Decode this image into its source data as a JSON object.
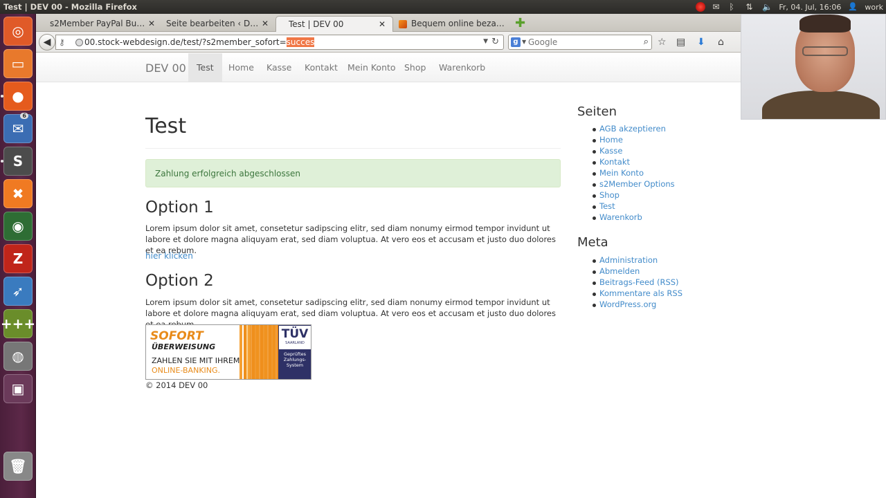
{
  "os": {
    "window_title": "Test | DEV 00 - Mozilla Firefox",
    "clock": "Fr, 04. Jul, 16:06",
    "user": "work",
    "launcher": [
      {
        "name": "ubuntu-dash-icon",
        "color": "#e05a28"
      },
      {
        "name": "files-icon",
        "color": "#e8792c"
      },
      {
        "name": "firefox-icon",
        "color": "#e55b1d"
      },
      {
        "name": "thunderbird-icon",
        "color": "#3b6db3",
        "badge": "6"
      },
      {
        "name": "sublime-text-icon",
        "color": "#4c4c4c"
      },
      {
        "name": "xampp-icon",
        "color": "#f07a22"
      },
      {
        "name": "shutter-icon",
        "color": "#2e6d34"
      },
      {
        "name": "filezilla-icon",
        "color": "#c0251a"
      },
      {
        "name": "bird-icon",
        "color": "#3a7bbf"
      },
      {
        "name": "calculator-icon",
        "color": "#6a8d2a"
      },
      {
        "name": "webcam-icon",
        "color": "#777777"
      },
      {
        "name": "workspace-switcher-icon",
        "color": "#6b3a5a"
      },
      {
        "name": "trash-icon",
        "color": "#888888"
      }
    ]
  },
  "browser": {
    "tabs": [
      {
        "label": "s2Member PayPal Butt…",
        "active": false
      },
      {
        "label": "Seite bearbeiten ‹ DEV …",
        "active": false
      },
      {
        "label": "Test | DEV 00",
        "active": true
      },
      {
        "label": "Bequem online beza…",
        "active": false
      }
    ],
    "url_main": "00.stock-webdesign.de/test/?s2member_sofort=",
    "url_selected": "succes",
    "search_placeholder": "Google"
  },
  "site": {
    "brand": "DEV 00",
    "nav": [
      "Test",
      "Home",
      "Kasse",
      "Kontakt",
      "Mein Konto",
      "Shop",
      "Warenkorb"
    ],
    "title": "Test",
    "alert": "Zahlung erfolgreich abgeschlossen",
    "option1_title": "Option 1",
    "option1_text": "Lorem ipsum dolor sit amet, consetetur sadipscing elitr, sed diam nonumy eirmod tempor invidunt ut labore et dolore magna aliquyam erat, sed diam voluptua. At vero eos et accusam et justo duo dolores et ea rebum.",
    "option1_link": "hier klicken",
    "option2_title": "Option 2",
    "option2_text": "Lorem ipsum dolor sit amet, consetetur sadipscing elitr, sed diam nonumy eirmod tempor invidunt ut labore et dolore magna aliquyam erat, sed diam voluptua. At vero eos et accusam et justo duo dolores et ea rebum.",
    "banner": {
      "line1": "SOFORT",
      "line2": "ÜBERWEISUNG",
      "line3": "ZAHLEN SIE MIT IHREM",
      "line4": "ONLINE-BANKING.",
      "tuv": "TÜV",
      "tuv_region": "SAARLAND",
      "tuv_text": "Geprüftes Zahlungs-System"
    },
    "footer": "© 2014 DEV 00",
    "sidebar": {
      "pages_title": "Seiten",
      "pages": [
        "AGB akzeptieren",
        "Home",
        "Kasse",
        "Kontakt",
        "Mein Konto",
        "s2Member Options",
        "Shop",
        "Test",
        "Warenkorb"
      ],
      "meta_title": "Meta",
      "meta": [
        "Administration",
        "Abmelden",
        "Beitrags-Feed (RSS)",
        "Kommentare als RSS",
        "WordPress.org"
      ]
    }
  }
}
